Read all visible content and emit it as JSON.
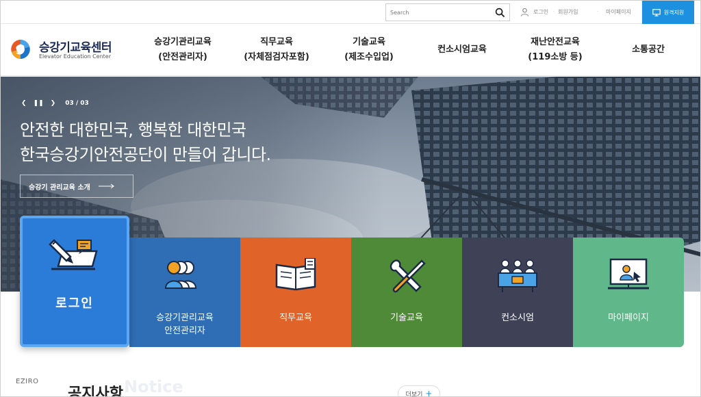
{
  "utility": {
    "search_placeholder": "Search",
    "login": "로그인",
    "join": "회원가입",
    "mypage": "마이페이지",
    "remote": "원격지원"
  },
  "logo": {
    "title": "승강기교육센터",
    "subtitle": "Elevator Education Center"
  },
  "nav": [
    {
      "line1": "승강기관리교육",
      "line2": "(안전관리자)"
    },
    {
      "line1": "직무교육",
      "line2": "(자체점검자포함)"
    },
    {
      "line1": "기술교육",
      "line2": "(제조수입업)"
    },
    {
      "line1": "컨소시엄교육",
      "line2": ""
    },
    {
      "line1": "재난안전교육",
      "line2": "(119소방 등)"
    },
    {
      "line1": "소통공간",
      "line2": ""
    }
  ],
  "hero": {
    "slide_counter": "03 / 03",
    "line1": "안전한 대한민국, 행복한 대한민국",
    "line2": "한국승강기안전공단이 만들어 갑니다.",
    "button": "승강기 관리교육 소개"
  },
  "tiles": {
    "login": "로그인",
    "items": [
      {
        "line1": "승강기관리교육",
        "line2": "안전관리자",
        "color": "#2f6db5"
      },
      {
        "line1": "직무교육",
        "line2": "",
        "color": "#e0632a"
      },
      {
        "line1": "기술교육",
        "line2": "",
        "color": "#4e8a38"
      },
      {
        "line1": "컨소시엄",
        "line2": "",
        "color": "#3f4256"
      },
      {
        "line1": "마이페이지",
        "line2": "",
        "color": "#5fb78a"
      }
    ]
  },
  "bottom": {
    "brand": "EZIRO",
    "notice_title": "공지사항",
    "notice_ghost": "Notice",
    "more": "더보기"
  },
  "colors": {
    "accent": "#1e90e0",
    "navy": "#1c2a57",
    "login_tile": "#2b7bd8"
  }
}
